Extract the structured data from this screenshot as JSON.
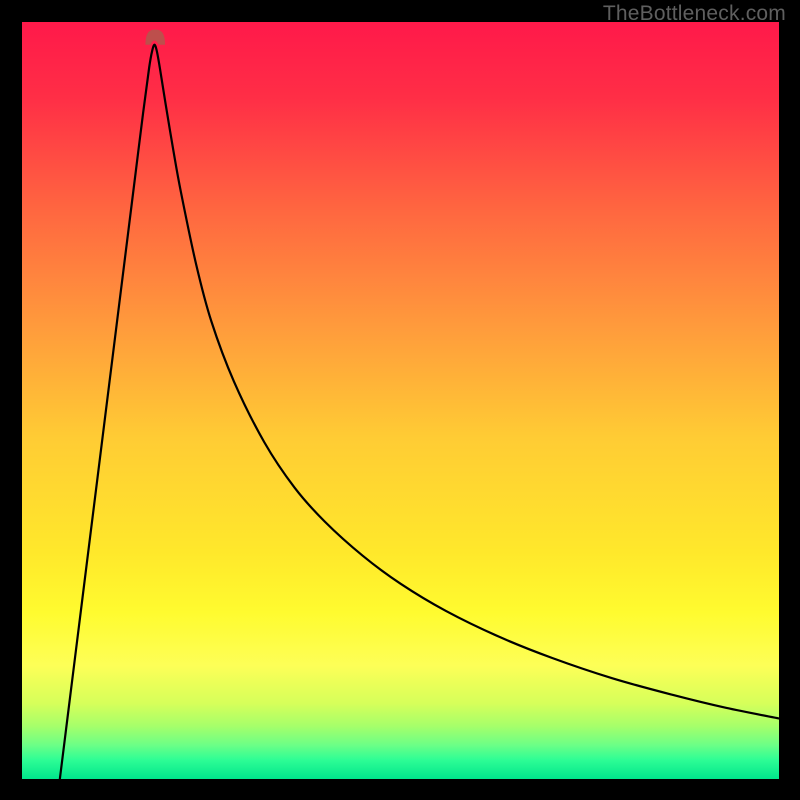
{
  "watermark": {
    "text": "TheBottleneck.com"
  },
  "chart_data": {
    "type": "line",
    "title": "",
    "xlabel": "",
    "ylabel": "",
    "xlim": [
      0,
      100
    ],
    "ylim": [
      0,
      100
    ],
    "legend": false,
    "grid": false,
    "background": {
      "type": "vertical-gradient",
      "stops": [
        {
          "pos": 0.0,
          "color": "#ff194a"
        },
        {
          "pos": 0.1,
          "color": "#ff2e46"
        },
        {
          "pos": 0.25,
          "color": "#ff6740"
        },
        {
          "pos": 0.4,
          "color": "#ff9a3c"
        },
        {
          "pos": 0.55,
          "color": "#ffcc34"
        },
        {
          "pos": 0.7,
          "color": "#ffe82b"
        },
        {
          "pos": 0.78,
          "color": "#fffb2f"
        },
        {
          "pos": 0.85,
          "color": "#fdff57"
        },
        {
          "pos": 0.9,
          "color": "#d6ff5a"
        },
        {
          "pos": 0.93,
          "color": "#a6ff6a"
        },
        {
          "pos": 0.955,
          "color": "#6cff86"
        },
        {
          "pos": 0.975,
          "color": "#2dfd95"
        },
        {
          "pos": 1.0,
          "color": "#00e58c"
        }
      ]
    },
    "notch": {
      "x_center": 17.5,
      "x_left": 16.3,
      "x_right": 18.9,
      "y_top": 97.0,
      "y_bottom": 99.0,
      "color": "#bd4f4c"
    },
    "series": [
      {
        "name": "bottleneck-curve",
        "stroke": "#000000",
        "stroke_width": 2.2,
        "x": [
          5.0,
          6.0,
          7.0,
          8.0,
          9.0,
          10.0,
          11.0,
          12.0,
          13.0,
          14.0,
          15.0,
          16.0,
          16.8,
          17.2,
          17.5,
          17.8,
          18.2,
          19.0,
          20.0,
          21.0,
          23.0,
          25.0,
          28.0,
          32.0,
          36.0,
          40.0,
          45.0,
          50.0,
          56.0,
          63.0,
          70.0,
          78.0,
          86.0,
          93.0,
          100.0
        ],
        "y": [
          0.0,
          8.0,
          16.0,
          24.0,
          32.0,
          40.0,
          48.0,
          56.0,
          64.0,
          72.0,
          80.0,
          88.0,
          94.0,
          96.2,
          97.0,
          96.2,
          94.0,
          89.0,
          83.0,
          77.5,
          68.0,
          60.5,
          52.5,
          44.5,
          38.5,
          34.0,
          29.5,
          25.8,
          22.2,
          18.8,
          16.0,
          13.3,
          11.1,
          9.4,
          8.0
        ]
      }
    ]
  }
}
